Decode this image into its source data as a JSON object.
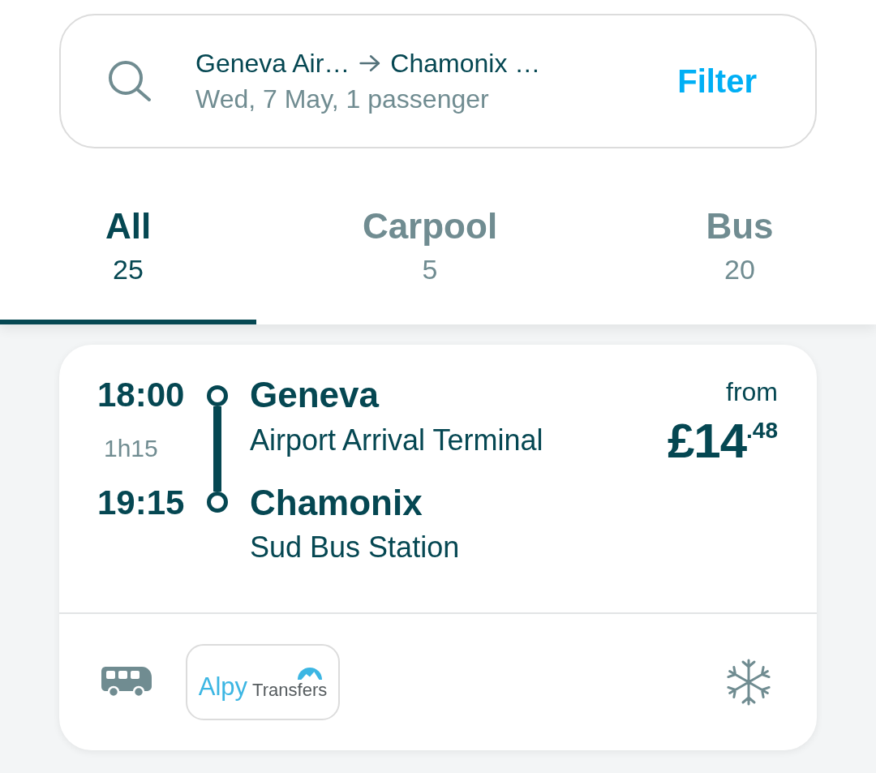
{
  "search": {
    "origin": "Geneva Air…",
    "destination": "Chamonix …",
    "details": "Wed, 7 May, 1 passenger",
    "filter_button": "Filter"
  },
  "tabs": [
    {
      "label": "All",
      "count": "25",
      "selected": true
    },
    {
      "label": "Carpool",
      "count": "5",
      "selected": false
    },
    {
      "label": "Bus",
      "count": "20",
      "selected": false
    }
  ],
  "results": [
    {
      "departure_time": "18:00",
      "duration": "1h15",
      "arrival_time": "19:15",
      "origin_city": "Geneva",
      "origin_stop": "Airport Arrival Terminal",
      "destination_city": "Chamonix",
      "destination_stop": "Sud Bus Station",
      "price_label": "from",
      "price": "£14$^{.48}$",
      "operator_logo": {
        "name": "Alpy",
        "subtitle": "Transfers"
      }
    }
  ]
}
